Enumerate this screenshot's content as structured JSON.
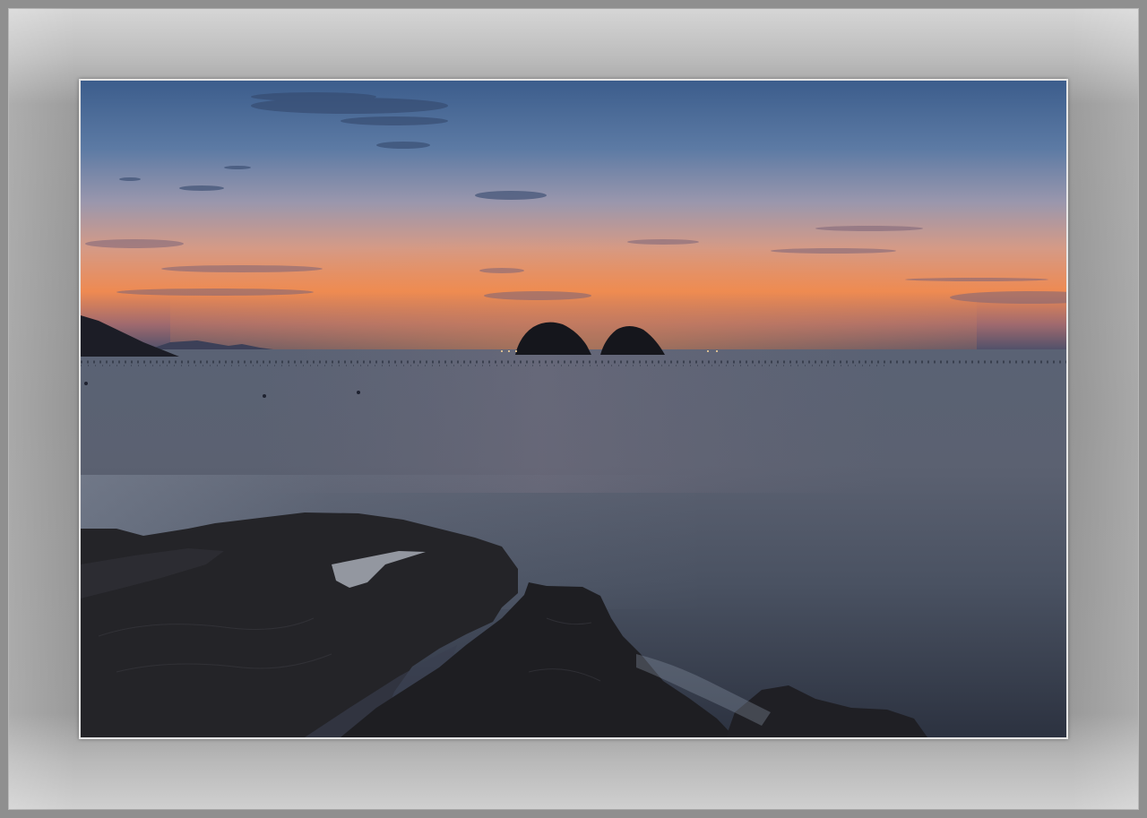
{
  "image": {
    "subject": "",
    "colors": {
      "sky_top": "#3f5f8e",
      "sky_mid": "#8a8aa8",
      "horizon_glow": "#e8804a",
      "sea": "#4a5566",
      "rocks": "#1e1e22",
      "mat": "#9a9a9a",
      "frame": "#8f8f8f"
    }
  }
}
